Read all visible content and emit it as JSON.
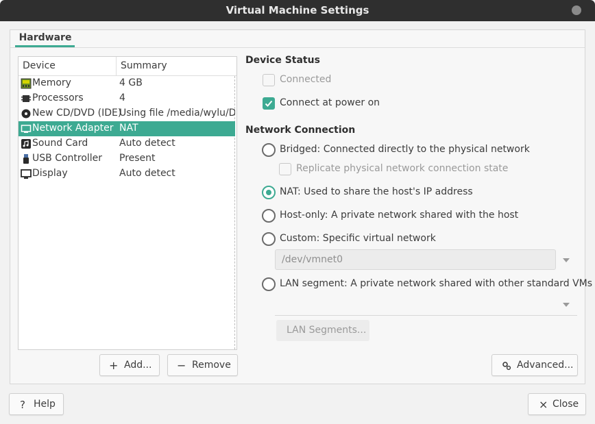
{
  "window": {
    "title": "Virtual Machine Settings"
  },
  "tabs": {
    "hardware": "Hardware"
  },
  "device_list": {
    "headers": {
      "device": "Device",
      "summary": "Summary"
    },
    "rows": [
      {
        "device": "Memory",
        "summary": "4 GB",
        "icon": "memory-icon"
      },
      {
        "device": "Processors",
        "summary": "4",
        "icon": "processor-icon"
      },
      {
        "device": "New CD/DVD (IDE)",
        "summary": "Using file /media/wylu/Dat",
        "icon": "cd-dvd-icon"
      },
      {
        "device": "Network Adapter",
        "summary": "NAT",
        "icon": "network-adapter-icon",
        "selected": true
      },
      {
        "device": "Sound Card",
        "summary": "Auto detect",
        "icon": "sound-card-icon"
      },
      {
        "device": "USB Controller",
        "summary": "Present",
        "icon": "usb-icon"
      },
      {
        "device": "Display",
        "summary": "Auto detect",
        "icon": "display-icon"
      }
    ]
  },
  "list_buttons": {
    "add": "Add...",
    "remove": "Remove"
  },
  "device_status": {
    "title": "Device Status",
    "connected": {
      "label": "Connected",
      "checked": false,
      "disabled": true
    },
    "connect_at_power_on": {
      "label": "Connect at power on",
      "checked": true
    }
  },
  "network_connection": {
    "title": "Network Connection",
    "bridged": "Bridged: Connected directly to the physical network",
    "replicate": "Replicate physical network connection state",
    "nat": "NAT: Used to share the host's IP address",
    "host_only": "Host-only: A private network shared with the host",
    "custom": "Custom: Specific virtual network",
    "custom_value": "/dev/vmnet0",
    "lan_segment": "LAN segment: A private network shared with other standard VMs",
    "lan_segments_button": "LAN Segments...",
    "selected": "nat"
  },
  "advanced_button": "Advanced...",
  "footer": {
    "help": "Help",
    "close": "Close"
  },
  "colors": {
    "accent": "#3daa92",
    "titlebar": "#2f2f2f",
    "background": "#f2f2f2"
  }
}
